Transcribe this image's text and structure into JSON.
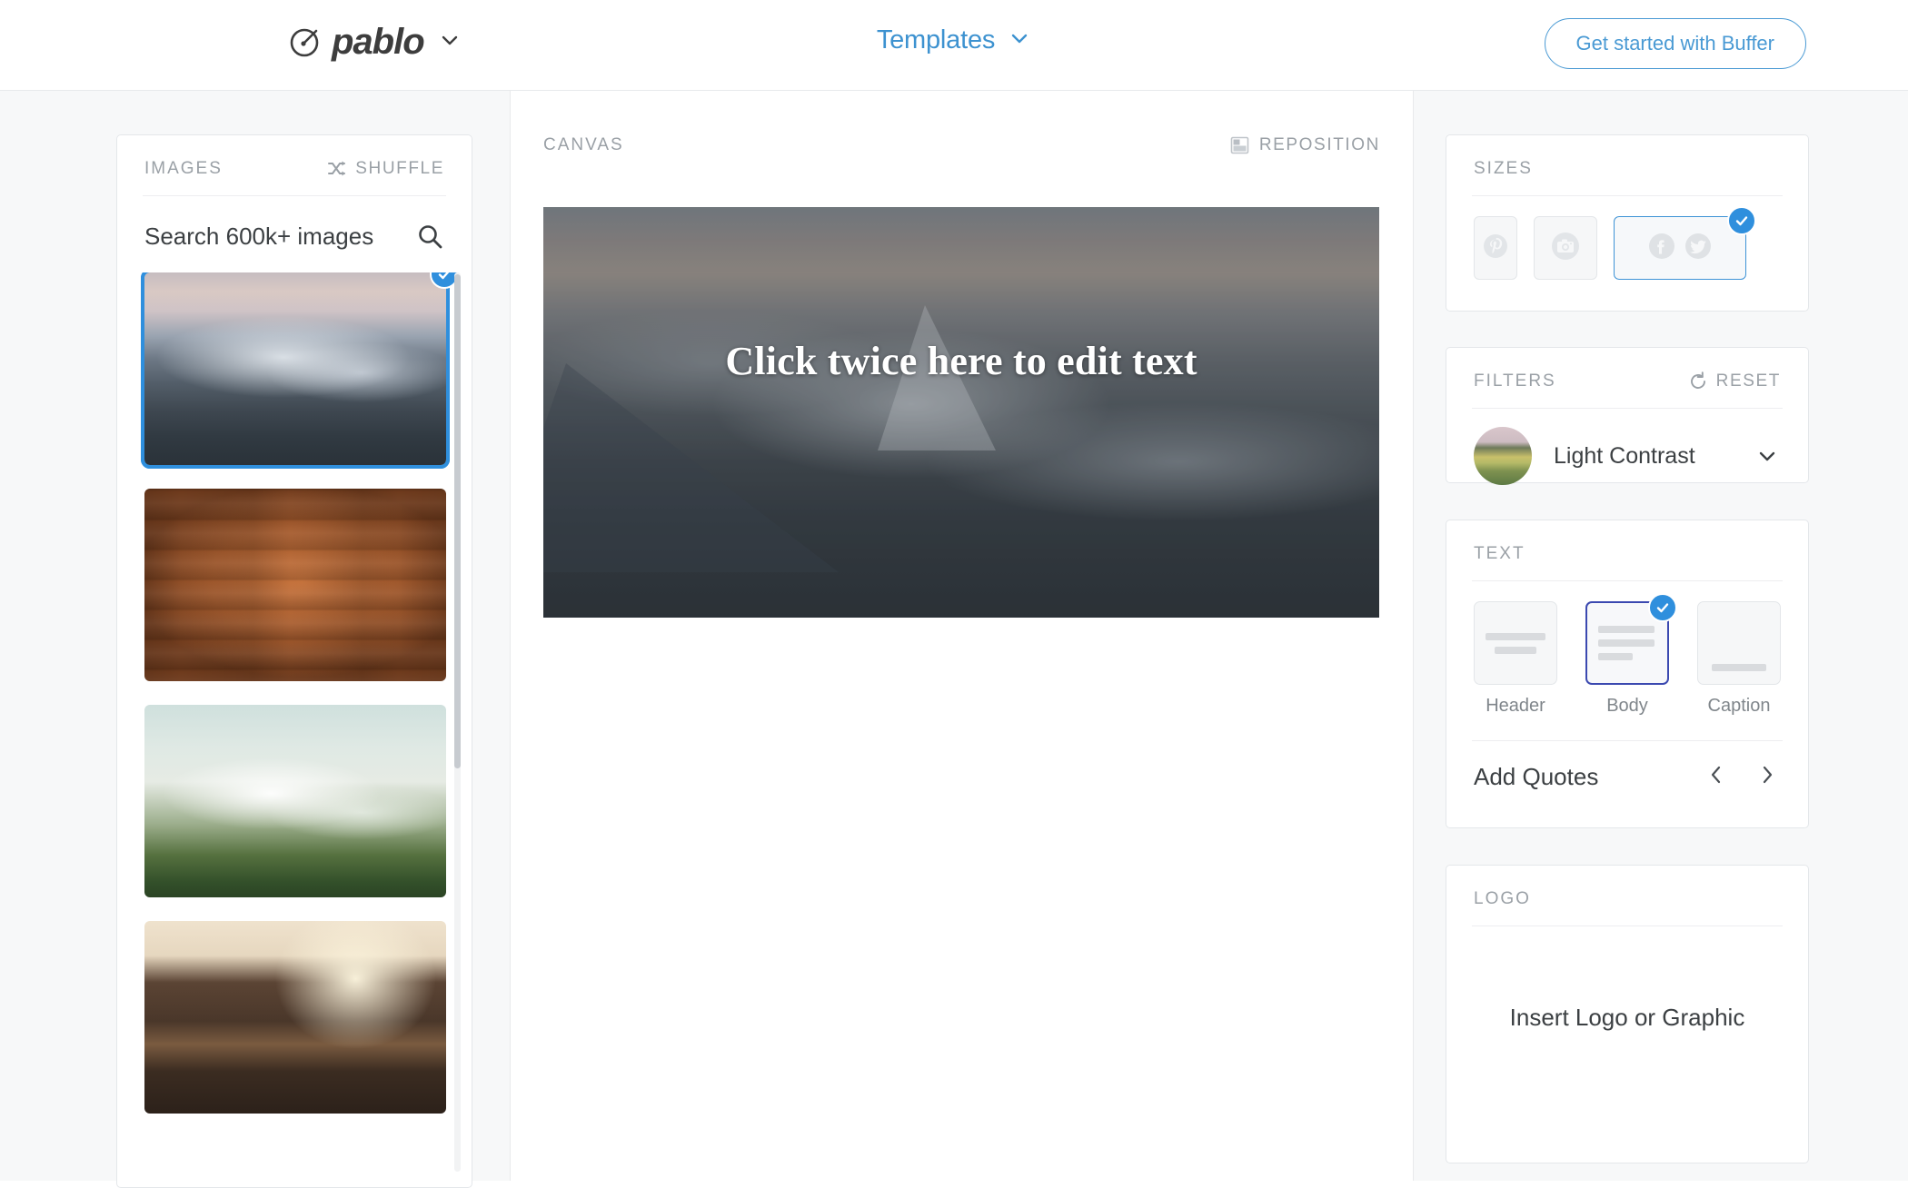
{
  "topbar": {
    "brand_name": "pablo",
    "brand_icon": "pablo-circle-brush-icon",
    "brand_caret_icon": "chevron-down-icon",
    "templates_label": "Templates",
    "templates_caret_icon": "chevron-down-icon",
    "cta_label": "Get started with Buffer"
  },
  "images_panel": {
    "title": "IMAGES",
    "shuffle_label": "SHUFFLE",
    "shuffle_icon": "shuffle-icon",
    "search_placeholder": "Search 600k+ images",
    "search_value": "",
    "search_icon": "search-icon",
    "thumbnails": [
      {
        "name": "snowy-mountain-sunset",
        "selected": true,
        "check_icon": "check-icon"
      },
      {
        "name": "wood-planks",
        "selected": false,
        "check_icon": ""
      },
      {
        "name": "misty-green-mountain",
        "selected": false,
        "check_icon": ""
      },
      {
        "name": "sunlit-living-room",
        "selected": false,
        "check_icon": ""
      }
    ]
  },
  "canvas_panel": {
    "title": "CANVAS",
    "reposition_label": "REPOSITION",
    "reposition_icon": "reposition-icon",
    "canvas_text": "Click twice here to edit text",
    "canvas_image": "snowy-mountain-sunset"
  },
  "sizes_panel": {
    "title": "SIZES",
    "options": [
      {
        "name": "pinterest",
        "icon": "pinterest-icon",
        "selected": false
      },
      {
        "name": "instagram",
        "icon": "instagram-camera-icon",
        "selected": false
      },
      {
        "name": "facebook-twitter",
        "icon": "facebook-icon,twitter-icon",
        "selected": true
      }
    ],
    "check_icon": "check-icon"
  },
  "filters_panel": {
    "title": "FILTERS",
    "reset_label": "RESET",
    "reset_icon": "reset-circular-arrow-icon",
    "selected_filter": "Light Contrast",
    "filter_thumb": "field-landscape-thumbnail",
    "caret_icon": "chevron-down-icon"
  },
  "text_panel": {
    "title": "TEXT",
    "options": [
      {
        "label": "Header",
        "selected": false
      },
      {
        "label": "Body",
        "selected": true
      },
      {
        "label": "Caption",
        "selected": false
      }
    ],
    "check_icon": "check-icon",
    "quotes_label": "Add Quotes",
    "prev_icon": "chevron-left-icon",
    "next_icon": "chevron-right-icon"
  },
  "logo_panel": {
    "title": "LOGO",
    "insert_label": "Insert Logo or Graphic"
  },
  "colors": {
    "accent_blue": "#2f8fdd",
    "link_blue": "#3d92d0",
    "selected_indigo": "#3b49b0",
    "muted_gray": "#9aa0a6",
    "text_dark": "#3c4043",
    "page_bg": "#f7f8f9"
  }
}
